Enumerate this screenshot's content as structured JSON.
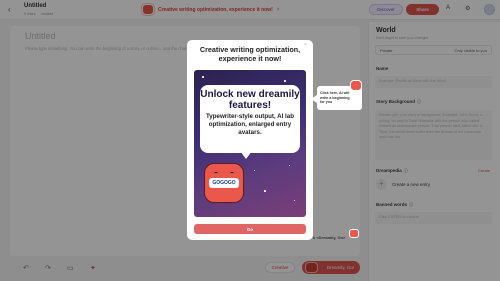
{
  "header": {
    "title": "Untitled",
    "characters": "0 chars",
    "saved_status": "created",
    "promo_text": "Creative writing optimization, experience it now!",
    "discover_label": "Discover",
    "share_label": "Share"
  },
  "editor": {
    "title_placeholder": "Untitled",
    "hint": "Please type something. You can write the beginning of a story, or outline... and the character"
  },
  "bottom": {
    "creative_label": "Creative",
    "dreamily_label": "Dreamily, Go!"
  },
  "panel": {
    "title": "World",
    "subtitle": "Don't forget to save your changes",
    "visibility_label": "Private",
    "visibility_value": "Only visible to you",
    "name_label": "Name",
    "name_placeholder": "Example: Pacific of Gone with the Wind",
    "background_label": "Story Background",
    "background_placeholder": "Please give your story a background. Example: John Snow, a young, on way to Tarat Nomadia with the person who called himself an unfortunate person. That person died, killed him. In Time, the world there suffer from the threats of Ice Lemmons and from the",
    "dreampedia_label": "Dreampedia",
    "create_link": "Create",
    "new_entry_label": "Create a new entry",
    "banned_label": "Banned words",
    "banned_placeholder": "Click ENTER to confirm"
  },
  "modal": {
    "title": "Creative writing optimization, experience it now!",
    "headline": "Unlock new dreamily features!",
    "body": "Typewriter-style output, AI lab optimization, enlarged entry avatars.",
    "mascot_label": "GOGOGO",
    "go_label": "Go",
    "close_symbol": "×"
  },
  "tooltip": {
    "text": "Click here, AI will write a beginning for you"
  },
  "callout": {
    "text": "k <Dreamily, Go>"
  },
  "colors": {
    "accent": "#e05650",
    "overlay": "rgba(0,0,0,0.42)"
  }
}
